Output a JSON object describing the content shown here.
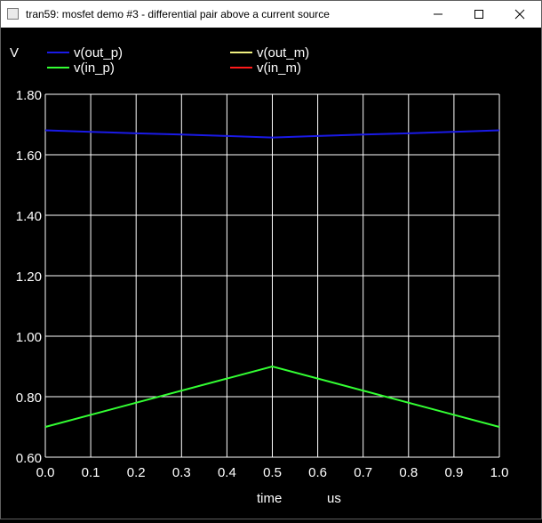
{
  "window": {
    "title": "tran59: mosfet demo #3 - differential pair above a current source",
    "controls": {
      "minimize": "minimize-icon",
      "maximize": "maximize-icon",
      "close": "close-icon"
    }
  },
  "colors": {
    "background": "#000000",
    "grid": "#ffffff",
    "axis_text": "#ffffff"
  },
  "chart_data": {
    "type": "line",
    "ylabel": "V",
    "xlabel": "time",
    "xunit": "us",
    "xlim": [
      0.0,
      1.0
    ],
    "ylim": [
      0.6,
      1.8
    ],
    "x_ticks": [
      "0.0",
      "0.1",
      "0.2",
      "0.3",
      "0.4",
      "0.5",
      "0.6",
      "0.7",
      "0.8",
      "0.9",
      "1.0"
    ],
    "y_ticks": [
      "0.60",
      "0.80",
      "1.00",
      "1.20",
      "1.40",
      "1.60",
      "1.80"
    ],
    "grid": true,
    "legend_position": "top",
    "series": [
      {
        "name": "v(out_p)",
        "color": "#1a1ae6",
        "points": [
          [
            0.0,
            1.681
          ],
          [
            0.1,
            1.676
          ],
          [
            0.2,
            1.671
          ],
          [
            0.3,
            1.667
          ],
          [
            0.4,
            1.662
          ],
          [
            0.5,
            1.657
          ],
          [
            0.6,
            1.662
          ],
          [
            0.7,
            1.667
          ],
          [
            0.8,
            1.671
          ],
          [
            0.9,
            1.676
          ],
          [
            1.0,
            1.681
          ]
        ]
      },
      {
        "name": "v(out_m)",
        "color": "#f0f080",
        "points": []
      },
      {
        "name": "v(in_p)",
        "color": "#33ff33",
        "points": [
          [
            0.0,
            0.7
          ],
          [
            0.5,
            0.9
          ],
          [
            1.0,
            0.7
          ]
        ]
      },
      {
        "name": "v(in_m)",
        "color": "#ff1a1a",
        "points": []
      }
    ]
  }
}
